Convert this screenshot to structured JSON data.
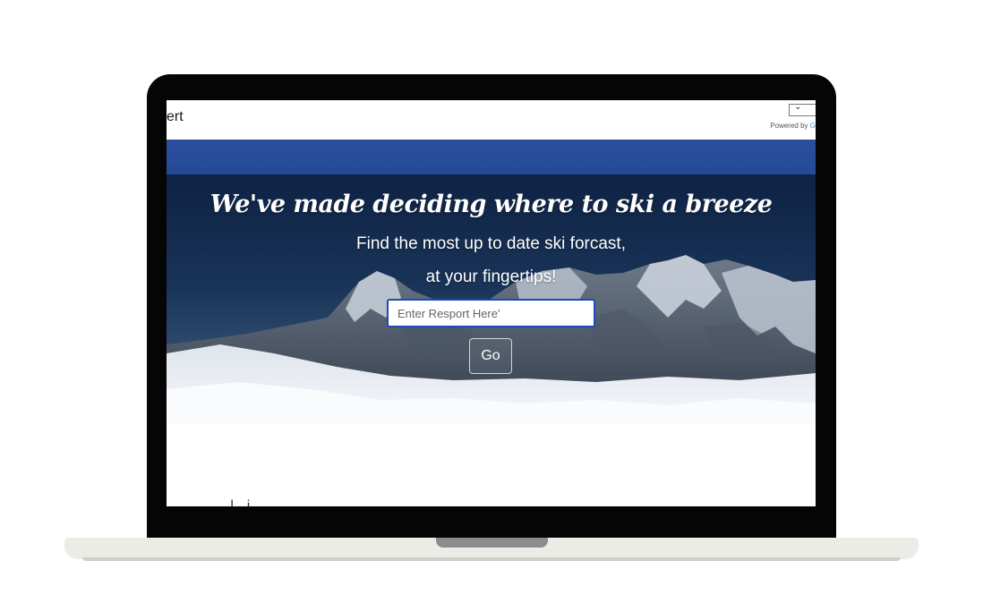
{
  "site": {
    "brand_text": "ert",
    "translate": {
      "selected": "",
      "powered_by_prefix": "Powered by",
      "powered_by_brand": "G"
    }
  },
  "hero": {
    "title": "We've made deciding where to ski a breeze",
    "subtitle_line1": "Find the most up to date ski forcast,",
    "subtitle_line2": "at your fingertips!",
    "search": {
      "placeholder": "Enter Resport Here'",
      "value": ""
    },
    "go_label": "Go"
  },
  "content": {
    "cut_off_text": "...l..i.."
  },
  "colors": {
    "blue_band": "#2a4f9e",
    "input_border": "#1e49b8",
    "laptop_bezel": "#050505",
    "laptop_base": "#ecece6"
  },
  "icons": {
    "translate_dropdown": "chevron-down-icon"
  }
}
